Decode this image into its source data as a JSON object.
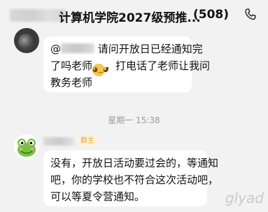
{
  "header": {
    "title": "计算机学院2027级预推...",
    "count": "(508)",
    "phone_icon": "phone-icon"
  },
  "messages": [
    {
      "lines": [
        "@",
        "请问开放日已经通知完",
        "了吗老师",
        "，打电话了老师让我问",
        "教务老师"
      ]
    },
    {
      "role_badge": "群主",
      "lines": [
        "没有，开放日活动要过会的，等通知",
        "吧，你的学校也不符合这次活动吧，",
        "可以等夏令营通知。"
      ]
    }
  ],
  "divider": "星期一 15:38",
  "watermark": "glyad",
  "colors": {
    "background": "#f2f2f2",
    "bubble": "#ffffff",
    "badge_text": "#e3a23b",
    "badge_bg": "#fff2d6"
  }
}
